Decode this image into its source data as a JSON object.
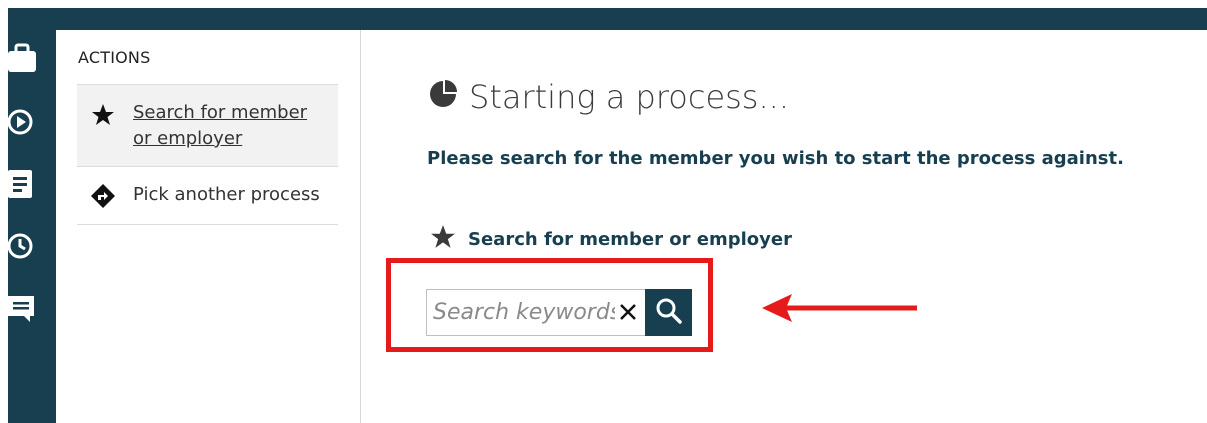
{
  "colors": {
    "navy": "#173f50",
    "annotation_red": "#e51b1b",
    "selected_bg": "#f2f2f2"
  },
  "rail": {
    "icons": [
      "briefcase-icon",
      "play-circle-icon",
      "document-icon",
      "history-icon",
      "chat-icon"
    ]
  },
  "actions": {
    "title": "ACTIONS",
    "items": [
      {
        "label": "Search for member or employer",
        "icon": "star-icon",
        "selected": true
      },
      {
        "label": "Pick another process",
        "icon": "directions-icon",
        "selected": false
      }
    ]
  },
  "main": {
    "title": "Starting a process...",
    "title_icon": "pie-chart-icon",
    "instructions": "Please search for the member you wish to start the process against.",
    "section_heading": "Search for member or employer",
    "section_icon": "star-icon",
    "search": {
      "placeholder": "Search keywords...",
      "value": "",
      "clear_icon": "close-icon",
      "submit_icon": "search-icon"
    }
  },
  "annotation": {
    "highlight_color": "#e51b1b",
    "arrow_direction": "left"
  }
}
